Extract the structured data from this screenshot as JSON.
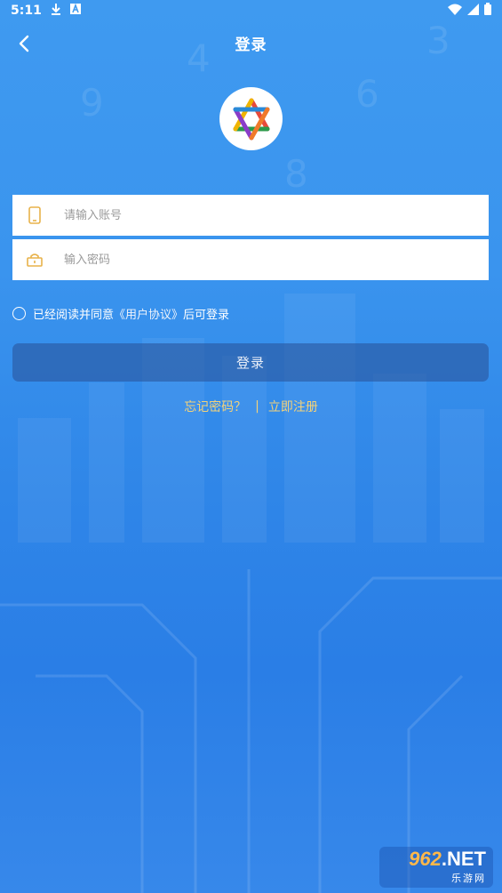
{
  "statusbar": {
    "time": "5:11"
  },
  "header": {
    "title": "登录"
  },
  "form": {
    "account_placeholder": "请输入账号",
    "password_placeholder": "输入密码"
  },
  "agreement": {
    "prefix": "已经阅读并同意",
    "link": "《用户协议》",
    "suffix": "后可登录"
  },
  "login_button": "登录",
  "links": {
    "forgot": "忘记密码？",
    "separator": "|",
    "register": "立即注册"
  },
  "watermark": {
    "main_num": "962",
    "main_rest": ".NET",
    "sub": "乐游网"
  },
  "colors": {
    "background": "#3a94ee",
    "accent_gold": "#f3d27a",
    "button_bg": "#2a5a9a",
    "field_icon": "#e8b24a"
  },
  "icons": [
    "download-icon",
    "font-a-icon",
    "wifi-icon",
    "signal-icon",
    "battery-icon",
    "back-arrow-icon",
    "app-logo-icon",
    "phone-icon",
    "lock-icon"
  ]
}
